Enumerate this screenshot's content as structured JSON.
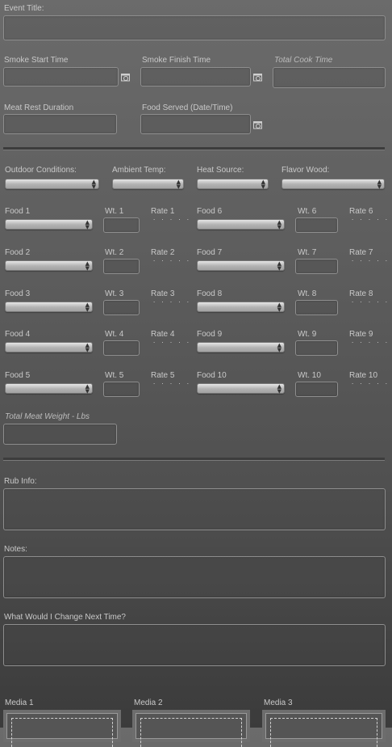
{
  "event": {
    "title_label": "Event Title:"
  },
  "times": {
    "smoke_start": "Smoke Start Time",
    "smoke_finish": "Smoke Finish Time",
    "total_cook": "Total Cook Time",
    "meat_rest": "Meat Rest Duration",
    "food_served": "Food Served (Date/Time)"
  },
  "conditions": {
    "outdoor": "Outdoor Conditions:",
    "ambient": "Ambient Temp:",
    "heat": "Heat Source:",
    "wood": "Flavor Wood:"
  },
  "foods_left": [
    {
      "food": "Food 1",
      "wt": "Wt. 1",
      "rate": "Rate 1"
    },
    {
      "food": "Food 2",
      "wt": "Wt. 2",
      "rate": "Rate 2"
    },
    {
      "food": "Food 3",
      "wt": "Wt. 3",
      "rate": "Rate 3"
    },
    {
      "food": "Food 4",
      "wt": "Wt. 4",
      "rate": "Rate 4"
    },
    {
      "food": "Food 5",
      "wt": "Wt. 5",
      "rate": "Rate 5"
    }
  ],
  "foods_right": [
    {
      "food": "Food 6",
      "wt": "Wt. 6",
      "rate": "Rate 6"
    },
    {
      "food": "Food 7",
      "wt": "Wt. 7",
      "rate": "Rate 7"
    },
    {
      "food": "Food 8",
      "wt": "Wt. 8",
      "rate": "Rate 8"
    },
    {
      "food": "Food 9",
      "wt": "Wt. 9",
      "rate": "Rate 9"
    },
    {
      "food": "Food 10",
      "wt": "Wt. 10",
      "rate": "Rate 10"
    }
  ],
  "rating_glyph": "· · · · ·",
  "total_weight": "Total Meat Weight - Lbs",
  "rub_info": "Rub Info:",
  "notes": "Notes:",
  "change_next": "What Would I Change Next Time?",
  "media": [
    "Media 1",
    "Media 2",
    "Media 3"
  ],
  "icons": {
    "calendar": "calendar-icon",
    "dropdown": "chevron-updown-icon"
  }
}
